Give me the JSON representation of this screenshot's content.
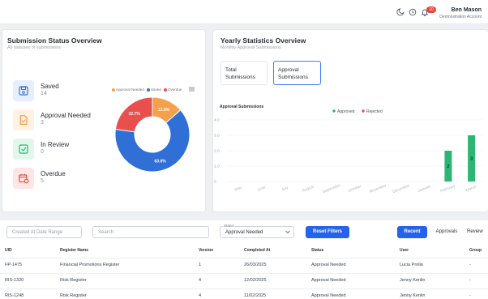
{
  "header": {
    "user_name": "Ben Mason",
    "user_role": "Demonstration Account",
    "notification_count": "10"
  },
  "submission_status": {
    "title": "Submission Status Overview",
    "subtitle": "All statuses of submissions",
    "items": [
      {
        "label": "Saved",
        "count": "14",
        "icon": "save-icon",
        "color": "#3b6fd4",
        "bg": "#e7efff"
      },
      {
        "label": "Approval Needed",
        "count": "3",
        "icon": "document-check-icon",
        "color": "#f0953a",
        "bg": "#fff1e3"
      },
      {
        "label": "In Review",
        "count": "0",
        "icon": "checkbox-icon",
        "color": "#2bb673",
        "bg": "#e3f6ec"
      },
      {
        "label": "Overdue",
        "count": "5",
        "icon": "calendar-clock-icon",
        "color": "#e0473d",
        "bg": "#fde6e4"
      }
    ],
    "legend": [
      "Approval Needed",
      "Saved",
      "Overdue"
    ]
  },
  "chart_data": [
    {
      "type": "pie",
      "categories": [
        "Approval Needed",
        "Saved",
        "Overdue"
      ],
      "values": [
        13.6,
        63.6,
        22.7
      ],
      "labels": [
        "13.6%",
        "63.6%",
        "22.7%"
      ],
      "colors": [
        "#f5a04a",
        "#2f6fd6",
        "#e8504d"
      ],
      "legend_position": "top"
    },
    {
      "type": "bar",
      "title": "Approval Submissions",
      "categories": [
        "May",
        "June",
        "July",
        "August",
        "September",
        "October",
        "November",
        "December",
        "January",
        "February",
        "March"
      ],
      "series": [
        {
          "name": "Approved",
          "values": [
            0,
            0,
            0,
            0,
            0,
            0,
            0,
            0,
            0,
            2,
            3
          ]
        },
        {
          "name": "Rejected",
          "values": [
            0,
            0,
            0,
            0,
            0,
            0,
            0,
            0,
            0,
            0,
            0
          ]
        }
      ],
      "bar_labels": [
        "2",
        "3"
      ],
      "colors": [
        "#2bb673",
        "#e8504d"
      ],
      "ylim": [
        0,
        4
      ],
      "yticks": [
        "0",
        "1.0",
        "2.0",
        "3.0",
        "4.0"
      ],
      "legend_position": "top"
    }
  ],
  "yearly": {
    "title": "Yearly Statistics Overview",
    "subtitle": "Monthly Approval Submissions",
    "tabs": [
      "Total Submissions",
      "Approval Submissions"
    ],
    "legend": [
      "Approved",
      "Rejected"
    ]
  },
  "filters": {
    "date_placeholder": "Created At Date Range",
    "search_placeholder": "Search",
    "status_legend": "Status",
    "status_value": "Approval Needed",
    "reset_label": "Reset Filters",
    "views": [
      "Recent",
      "Approvals",
      "Review"
    ]
  },
  "table": {
    "headers": [
      "UID",
      "Register Name",
      "Version",
      "Completed At",
      "Status",
      "User",
      "Group"
    ],
    "rows": [
      [
        "FP-1475",
        "Financial Promotions Register",
        "1",
        "26/03/2025",
        "Approval Needed",
        "Lucia Prolla",
        "-"
      ],
      [
        "RIS-1320",
        "Risk Register",
        "4",
        "12/02/2025",
        "Approval Needed",
        "Jenny Kenlin",
        "-"
      ],
      [
        "RIS-1248",
        "Risk Register",
        "4",
        "11/02/2025",
        "Approval Needed",
        "Jenny Kenlin",
        "-"
      ]
    ]
  }
}
